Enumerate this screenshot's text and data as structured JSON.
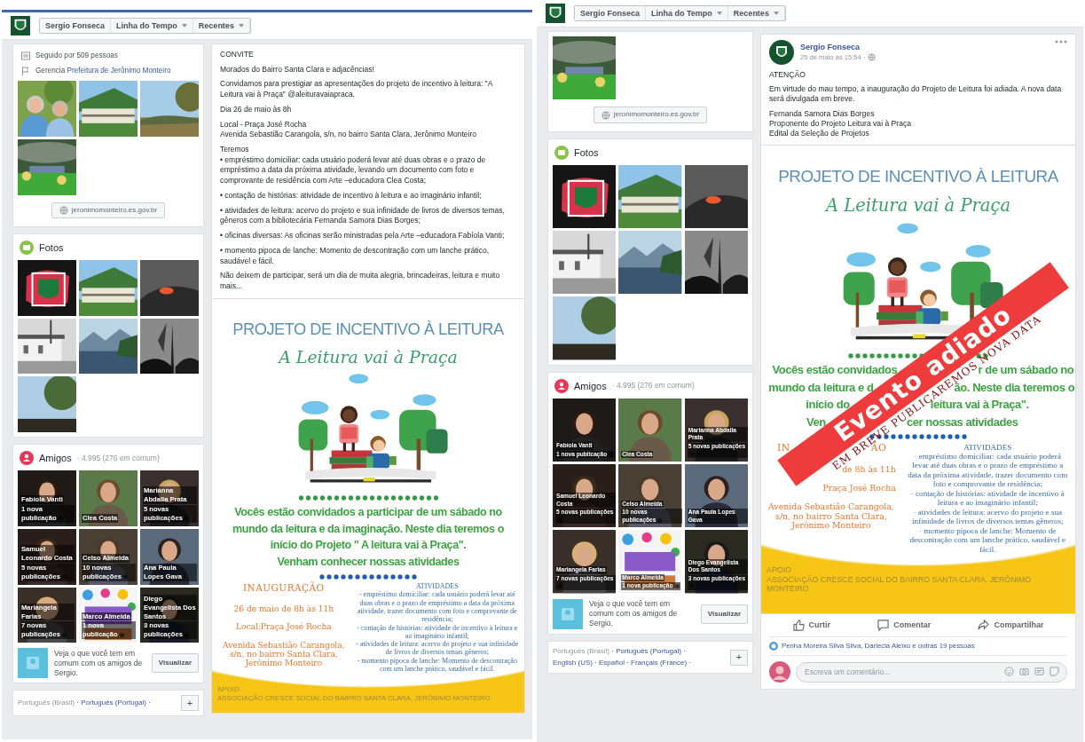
{
  "screens": [
    {
      "top_border": true,
      "header": {
        "buttons": [
          {
            "label": "Sergio Fonseca",
            "kind": "plain"
          },
          {
            "label": "Linha do Tempo",
            "kind": "dropdown"
          },
          {
            "label": "Recentes",
            "kind": "dropdown"
          }
        ]
      },
      "sidebar": {
        "about": [
          {
            "kind": "followers",
            "text": "Seguido por 509 pessoas"
          },
          {
            "kind": "manages",
            "text": "Gerencia",
            "link": "Prefeitura de Jerônimo Monteiro"
          }
        ],
        "website": "jeronimomonteiro.es.gov.br",
        "photos": {
          "title": "Fotos"
        },
        "friends": {
          "title": "Amigos",
          "count": "· 4.995 (276 em comum)",
          "items": [
            {
              "name": "Fabíola Vanti",
              "news": "1 nova publicação"
            },
            {
              "name": "Clea Costa"
            },
            {
              "name": "Marianna Abdalla Prata",
              "news": "5 novas publicações"
            },
            {
              "name": "Samuel Leonardo Costa",
              "news": "5 novas publicações"
            },
            {
              "name": "Celso Almeida",
              "news": "10 novas publicações"
            },
            {
              "name": "Ana Paula Lopes Gava"
            },
            {
              "name": "Mariangela Farias",
              "news": "7 novas publicações"
            },
            {
              "name": "Marco Almeida",
              "news": "1 nova publicação"
            },
            {
              "name": "Diego Evangelista Dos Santos",
              "news": "3 novas publicações"
            }
          ],
          "compare_text": "Veja o que você tem em comum com os amigos de Sergio.",
          "compare_button": "Visualizar"
        },
        "languages": {
          "separator": "·",
          "items": [
            {
              "label": "Português (Brasil)",
              "selected": true
            },
            {
              "label": "Português (Portugal)",
              "selected": false
            }
          ],
          "button": "+"
        }
      },
      "post": {
        "paragraphs": [
          "CONVITE",
          "Morados do Bairro Santa Clara e adjacências!",
          "Convidamos para prestigiar as apresentações do projeto de incentivo à leitura: \"A Leitura vai à Praça\" @aleituravaiapraca.",
          "Dia 26 de maio às 8h",
          "Local - Praça José Rocha\nAvenida Sebastião Carangola, s/n, no bairro Santa Clara, Jerônimo Monteiro",
          "Teremos\n• empréstimo domiciliar: cada usuário poderá levar até duas obras e o prazo de empréstimo a data da próxima atividade, levando um documento com foto e comprovante de residência com Arte –educadora Clea Costa;",
          "• contação de histórias: atividade de incentivo à leitura e ao imaginário infantil;",
          "• atividades de leitura: acervo do projeto e sua infinidade de livros de diversos temas, gêneros com a bibliotecária Fernanda Samora Dias Borges;",
          "• oficinas diversas: As oficinas serão ministradas pela Arte –educadora Fabíola Vanti;",
          "• momento pipoca de lanche: Momento de descontração com um lanche prático, saudável e fácil.",
          "Não deixem de participar, será um dia de muita alegria, brincadeiras, leitura e muito mais..."
        ],
        "flyer": {
          "title": "PROJETO DE INCENTIVO À LEITURA",
          "subtitle": "A Leitura vai à Praça",
          "invite": [
            [
              "Vocês estão convidados a participar de um sábado no"
            ],
            [
              "mundo da leitura e da imaginação. Neste dia teremos o"
            ],
            [
              "início do Projeto \" A leitura vai à Praça\"."
            ],
            [
              "Venham conhecer nossas atividades"
            ]
          ],
          "inauguration": {
            "title": [
              "INAUGURAÇÃO"
            ],
            "lines": [
              [
                "26 de maio de 8h às 11h"
              ],
              [
                "Local:Praça José Rocha"
              ],
              [
                "Avenida Sebastião Carangola, s/n, no bairro Santa Clara, Jerônimo Monteiro"
              ]
            ]
          },
          "activities": {
            "title": "ATIVIDADES",
            "text": "- empréstimo domiciliar: cada usuário poderá levar até duas obras e o prazo de empréstimo a data da próxima atividade, trazer documento com foto e comprovante de residência;\n- contação de histórias: atividade de incentivo à leitura e ao imaginário infantil;\n- atividades de leitura: acervo do projeto e sua infinidade de livros de diversos temas gêneros;\n- momento pipoca de lanche: Momento de descontração com um lanche prático, saudável e fácil."
          },
          "support": {
            "title": "APOIO",
            "text": "ASSOCIAÇÃO CRESCE SOCIAL DO BAIRRO SANTA CLARA, JERÔNIMO MONTEIRO"
          }
        }
      }
    },
    {
      "top_border": false,
      "header": {
        "buttons": [
          {
            "label": "Sergio Fonseca",
            "kind": "plain"
          },
          {
            "label": "Linha do Tempo",
            "kind": "dropdown"
          },
          {
            "label": "Recentes",
            "kind": "dropdown"
          }
        ]
      },
      "sidebar": {
        "website": "jeronimomonteiro.es.gov.br",
        "photos": {
          "title": "Fotos"
        },
        "friends": {
          "title": "Amigos",
          "count": "· 4.995 (276 em comum)",
          "items": [
            {
              "name": "Fabíola Vanti",
              "news": "1 nova publicação"
            },
            {
              "name": "Clea Costa"
            },
            {
              "name": "Marianna Abdalla Prata",
              "news": "5 novas publicações"
            },
            {
              "name": "Samuel Leonardo Costa",
              "news": "5 novas publicações"
            },
            {
              "name": "Celso Almeida",
              "news": "10 novas publicações"
            },
            {
              "name": "Ana Paula Lopes Gava"
            },
            {
              "name": "Mariangela Farias",
              "news": "7 novas publicações"
            },
            {
              "name": "Marco Almeida",
              "news": "1 nova publicação"
            },
            {
              "name": "Diego Evangelista Dos Santos",
              "news": "3 novas publicações"
            }
          ],
          "compare_text": "Veja o que você tem em comum com os amigos de Sergio.",
          "compare_button": "Visualizar"
        },
        "languages": {
          "separator": "·",
          "items": [
            {
              "label": "Português (Brasil)",
              "selected": true
            },
            {
              "label": "Português (Portugal)",
              "selected": false
            },
            {
              "label": "English (US)",
              "selected": false
            },
            {
              "label": "Español",
              "selected": false
            },
            {
              "label": "Français (France)",
              "selected": false
            }
          ],
          "button": "+"
        }
      },
      "post": {
        "author": "Sergio Fonseca",
        "time": "25 de maio às 15:54 ·",
        "paragraphs": [
          "ATENÇÃO",
          "Em virtude do mau tempo, a inauguração do Projeto de Leitura foi adiada. A nova data será divulgada em breve.",
          "Fernanda Samora Dias Borges\nProponente do Projeto Leitura vai à Praça\nEdital da Seleção de Projetos"
        ],
        "flyer": {
          "title": "PROJETO DE INCENTIVO À LEITURA",
          "subtitle": "A Leitura vai à Praça",
          "invite": [
            [
              "Vocês estão convidados",
              "r de um sábado no"
            ],
            [
              "mundo da leitura e d",
              "ão. Neste dia teremos o"
            ],
            [
              "início do",
              "leitura vai à Praça\"."
            ],
            [
              "Ven",
              "cer nossas atividades"
            ]
          ],
          "inauguration": {
            "title": [
              "IN",
              "ÃO"
            ],
            "lines": [
              [
                "de 8h às 11h"
              ],
              [
                "Praça José Rocha"
              ],
              [
                "Avenida Sebastião Carangola, s/n, no bairro Santa Clara, Jerônimo Monteiro"
              ]
            ]
          },
          "activities": {
            "title": "ATIVIDADES",
            "text": "· empréstimo domiciliar: cada usuário poderá levar até duas obras e o prazo de empréstimo a data da próxima atividade, trazer documento com foto e comprovante de residência;\n· contação de histórias: atividade de incentivo à leitura e ao imaginário infantil;\n· atividades de leitura: acervo do projeto e sua infinidade de livros de diversos temas gêneros;\n· momento pipoca de lanche: Momento de descontração com um lanche prático, saudável e fácil."
          },
          "support": {
            "title": "APOIO",
            "text": "ASSOCIAÇÃO CRESCE SOCIAL DO BAIRRO SANTA CLARA, JERÔNIMO MONTEIRO"
          },
          "banner": {
            "title": "Evento adiado",
            "subtitle": "EM BREVE PUBLICAREMOS NOVA DATA"
          }
        },
        "actions": [
          {
            "label": "Curtir",
            "kind": "like"
          },
          {
            "label": "Comentar",
            "kind": "comment"
          },
          {
            "label": "Compartilhar",
            "kind": "share"
          }
        ],
        "reactions": "Penha Moreira Silva Silva, Dariecla Aleixo e outras 19 pessoas",
        "comment": {
          "placeholder": "Escreva um comentário..."
        }
      }
    }
  ]
}
